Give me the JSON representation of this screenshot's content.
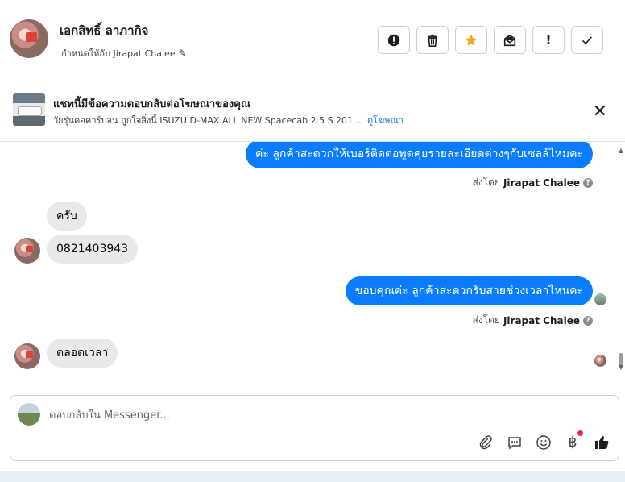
{
  "header": {
    "name": "เอกสิทธิ์ ลาภากิจ",
    "assigned": "กำหนดให้กับ Jirapat Chalee",
    "actions": [
      "spam-icon",
      "trash-icon",
      "star-icon",
      "mark-unread-icon",
      "important-icon",
      "done-icon"
    ]
  },
  "ad": {
    "title": "แชทนี้มีข้อความตอบกลับต่อโฆษณาของคุณ",
    "subtitle": "วัยรุ่นคอคาร์บอน ถูกใจสิ่งนี้ ISUZU D-MAX ALL NEW Spacecab 2.5 S 201...",
    "link": "ดูโฆษณา"
  },
  "messages": [
    {
      "dir": "out",
      "text": "ค่ะ ลูกค้าสะดวกให้เบอร์ติดต่อพูดคุยรายละเอียดต่างๆกับเซลล์ไหมคะ"
    },
    {
      "dir": "in",
      "text": "ครับ"
    },
    {
      "dir": "in",
      "text": "0821403943"
    },
    {
      "dir": "out",
      "text": "ขอบคุณค่ะ ลูกค้าสะดวกรับสายช่วงเวลาไหนคะ"
    },
    {
      "dir": "in",
      "text": "ตลอดเวลา"
    }
  ],
  "sent_by_prefix": "ส่งโดย",
  "sent_by_name": "Jirapat Chalee",
  "composer": {
    "placeholder": "ตอบกลับใน Messenger...",
    "tools": [
      "attach-icon",
      "saved-reply-icon",
      "emoji-icon",
      "payment-icon",
      "like-icon"
    ]
  },
  "colors": {
    "accent": "#0a7cff",
    "bubble_in": "#e9e9eb",
    "star": "#f5a623"
  }
}
